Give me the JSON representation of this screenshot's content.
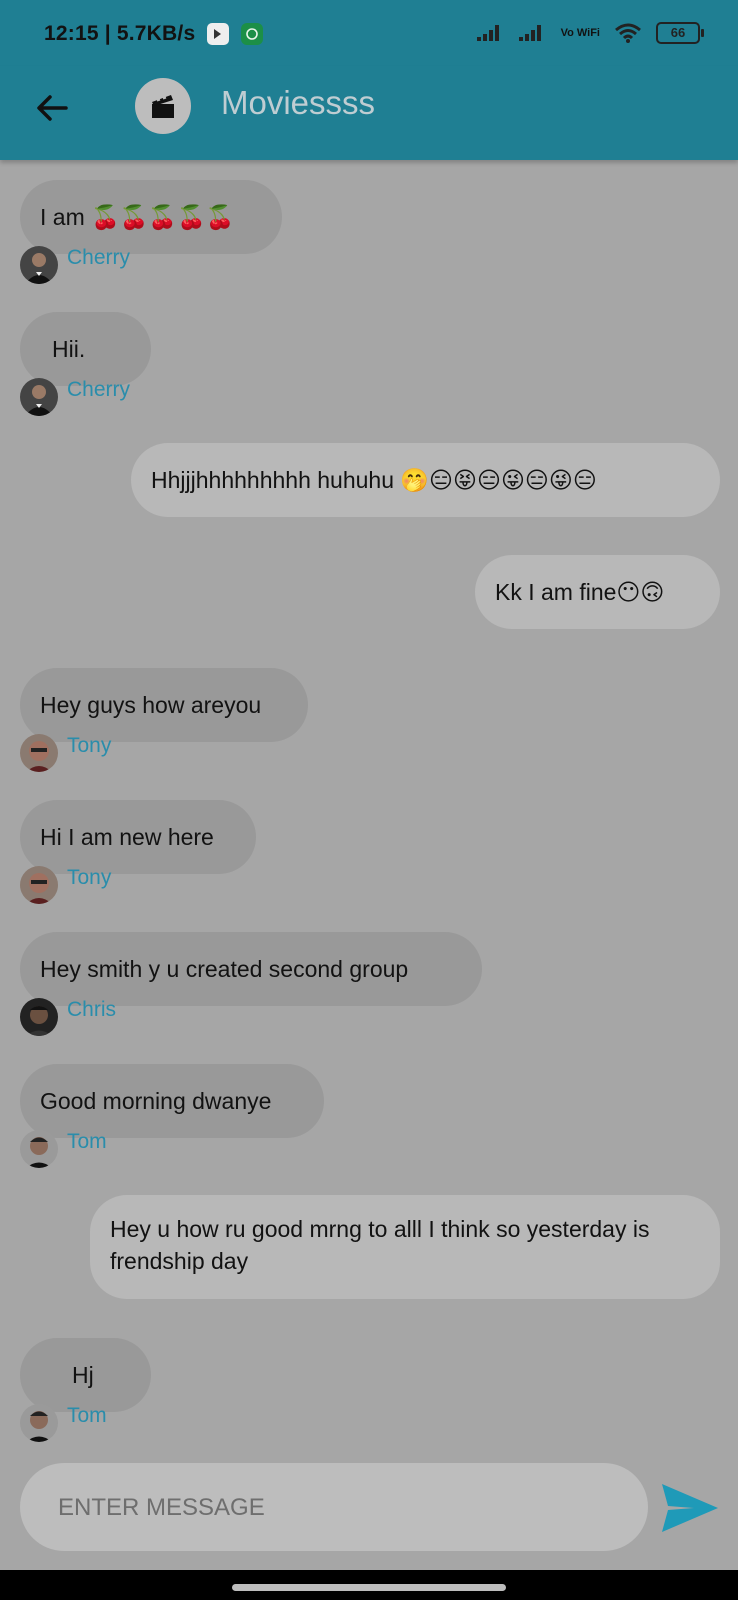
{
  "status_bar": {
    "time": "12:15",
    "speed": "5.7KB/s",
    "vowifi": "Vo WiFi",
    "battery": "66"
  },
  "header": {
    "title": "Moviessss",
    "back_icon": "arrow-back-icon",
    "group_icon": "clapperboard-icon"
  },
  "messages": [
    {
      "text": "I am 🍒🍒🍒🍒🍒",
      "sender": "Cherry",
      "direction": "in"
    },
    {
      "text": "Hii.",
      "sender": "Cherry",
      "direction": "in"
    },
    {
      "text": "Hhjjjhhhhhhhhh huhuhu 🤭😑😝😑😜😑😜😑",
      "direction": "out"
    },
    {
      "text": "Kk I am fine😶🙃",
      "direction": "out"
    },
    {
      "text": "Hey guys how areyou",
      "sender": "Tony",
      "direction": "in"
    },
    {
      "text": "Hi I am new here",
      "sender": "Tony",
      "direction": "in"
    },
    {
      "text": "Hey smith y u created second group",
      "sender": "Chris",
      "direction": "in"
    },
    {
      "text": "Good morning dwanye",
      "sender": "Tom",
      "direction": "in"
    },
    {
      "text": "Hey u how ru good mrng to alll I think so yesterday is frendship day",
      "direction": "out"
    },
    {
      "text": "Hj",
      "sender": "Tom",
      "direction": "in"
    }
  ],
  "composer": {
    "placeholder": "ENTER MESSAGE",
    "send_icon": "send-icon"
  },
  "colors": {
    "app_bar": "#1f7f93",
    "background": "#a6a6a6",
    "incoming_bubble": "#999999",
    "outgoing_bubble": "#b8b8b8",
    "sender_name": "#2a8dab",
    "send_button": "#1f9ab8"
  }
}
